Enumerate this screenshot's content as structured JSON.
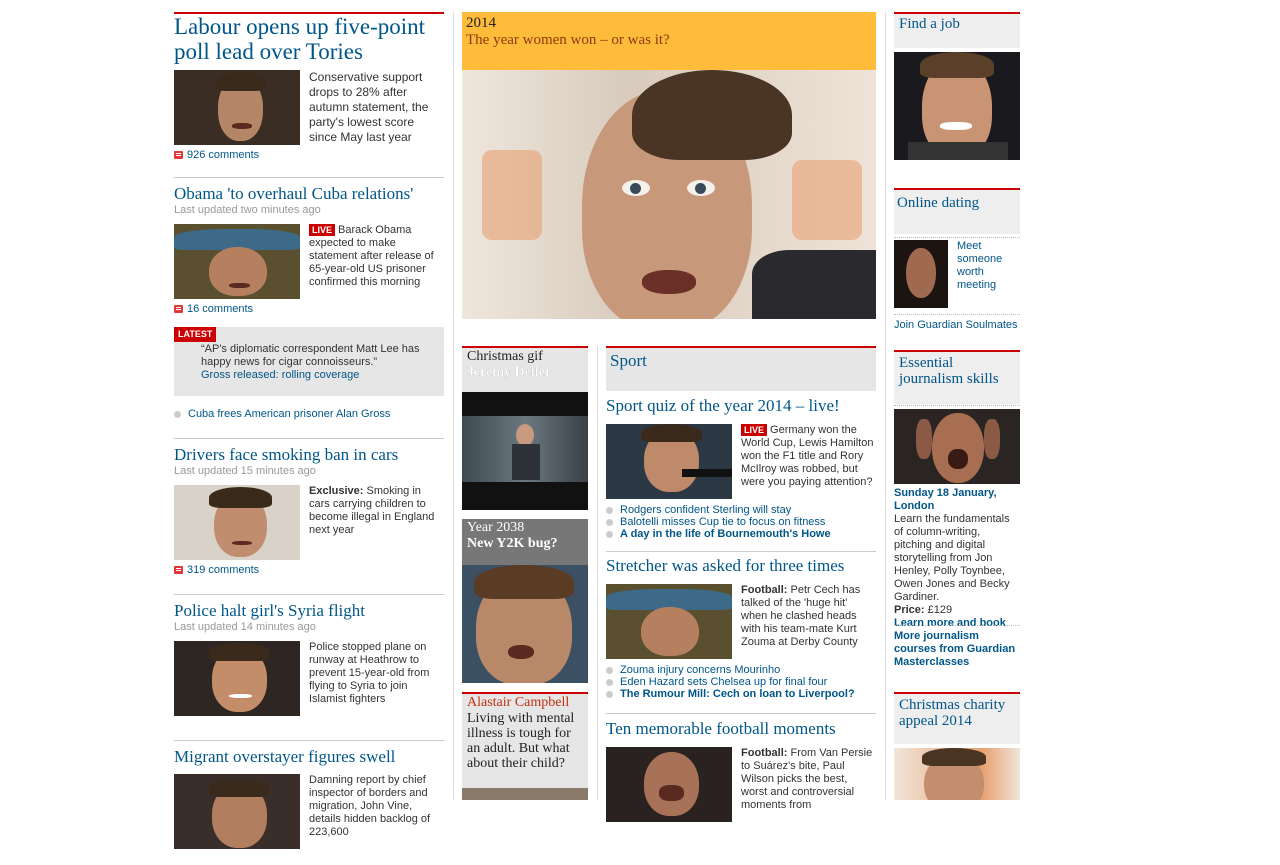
{
  "left": {
    "story1": {
      "title": "Labour opens up five-point poll lead over Tories",
      "snippet": "Conservative support drops to 28% after autumn statement, the party's lowest score since May last year",
      "comments": "926 comments"
    },
    "story2": {
      "title": "Obama 'to overhaul Cuba relations'",
      "updated": "Last updated two minutes ago",
      "live": "LIVE",
      "snippet": "Barack Obama expected to make statement after release of 65-year-old US prisoner confirmed this morning",
      "comments": "16 comments",
      "latest_tag": "LATEST",
      "latest_quote": "“AP's diplomatic correspondent Matt Lee has happy news for cigar connoisseurs.”",
      "latest_link": "Gross released: rolling coverage",
      "related": "Cuba frees American prisoner Alan Gross"
    },
    "story3": {
      "title": "Drivers face smoking ban in cars",
      "updated": "Last updated 15 minutes ago",
      "exclusive": "Exclusive:",
      "snippet": " Smoking in cars carrying children to become illegal in England next year",
      "comments": "319 comments"
    },
    "story4": {
      "title": "Police halt girl's Syria flight",
      "updated": "Last updated 14 minutes ago",
      "snippet": "Police stopped plane on runway at Heathrow to prevent 15-year-old from flying to Syria to join Islamist fighters"
    },
    "story5": {
      "title": "Migrant overstayer figures swell",
      "snippet": "Damning report by chief inspector of borders and migration, John Vine, details hidden backlog of 223,600"
    }
  },
  "feature": {
    "kicker": "2014",
    "title": "The year women won – or was it?"
  },
  "small": {
    "xmas_kicker": "Christmas gif",
    "xmas_title": "Jeremy Deller",
    "year_kicker": "Year 2038",
    "year_title": "New Y2K bug?",
    "campbell_kicker": "Alastair Campbell",
    "campbell_title": "Living with mental illness is tough for an adult. But what about their child?"
  },
  "sport": {
    "header": "Sport",
    "s1_title": "Sport quiz of the year 2014 – live!",
    "s1_live": "LIVE",
    "s1_snippet": "Germany won the World Cup, Lewis Hamilton won the F1 title and Rory McIlroy was robbed, but were you paying attention?",
    "s1_links": [
      "Rodgers confident Sterling will stay",
      "Balotelli misses Cup tie to focus on fitness",
      "A day in the life of Bournemouth's Howe"
    ],
    "s2_title": "Stretcher was asked for three times",
    "s2_label": "Football:",
    "s2_snippet": " Petr Cech has talked of the 'huge hit' when he clashed heads with his team-mate Kurt Zouma at Derby County",
    "s2_links": [
      "Zouma injury concerns Mourinho",
      "Eden Hazard sets Chelsea up for final four",
      "The Rumour Mill: Cech on loan to Liverpool?"
    ],
    "s3_title": "Ten memorable football moments",
    "s3_label": "Football:",
    "s3_snippet": " From Van Persie to Suárez's bite, Paul Wilson picks the best, worst and controversial moments from"
  },
  "right": {
    "job": "Find a job",
    "dating": "Online dating",
    "dating_text": "Meet someone worth meeting",
    "dating_link": "Join Guardian Soulmates",
    "skills": "Essential journalism skills",
    "skills_date": "Sunday 18 January, London",
    "skills_text": "Learn the fundamentals of column-writing, pitching and digital storytelling from Jon Henley, Polly Toynbee, Owen Jones and Becky Gardiner.",
    "skills_price_label": "Price:",
    "skills_price": " £129",
    "skills_book": "Learn more and book",
    "skills_more": "More journalism courses from Guardian Masterclasses",
    "charity": "Christmas charity appeal 2014"
  }
}
